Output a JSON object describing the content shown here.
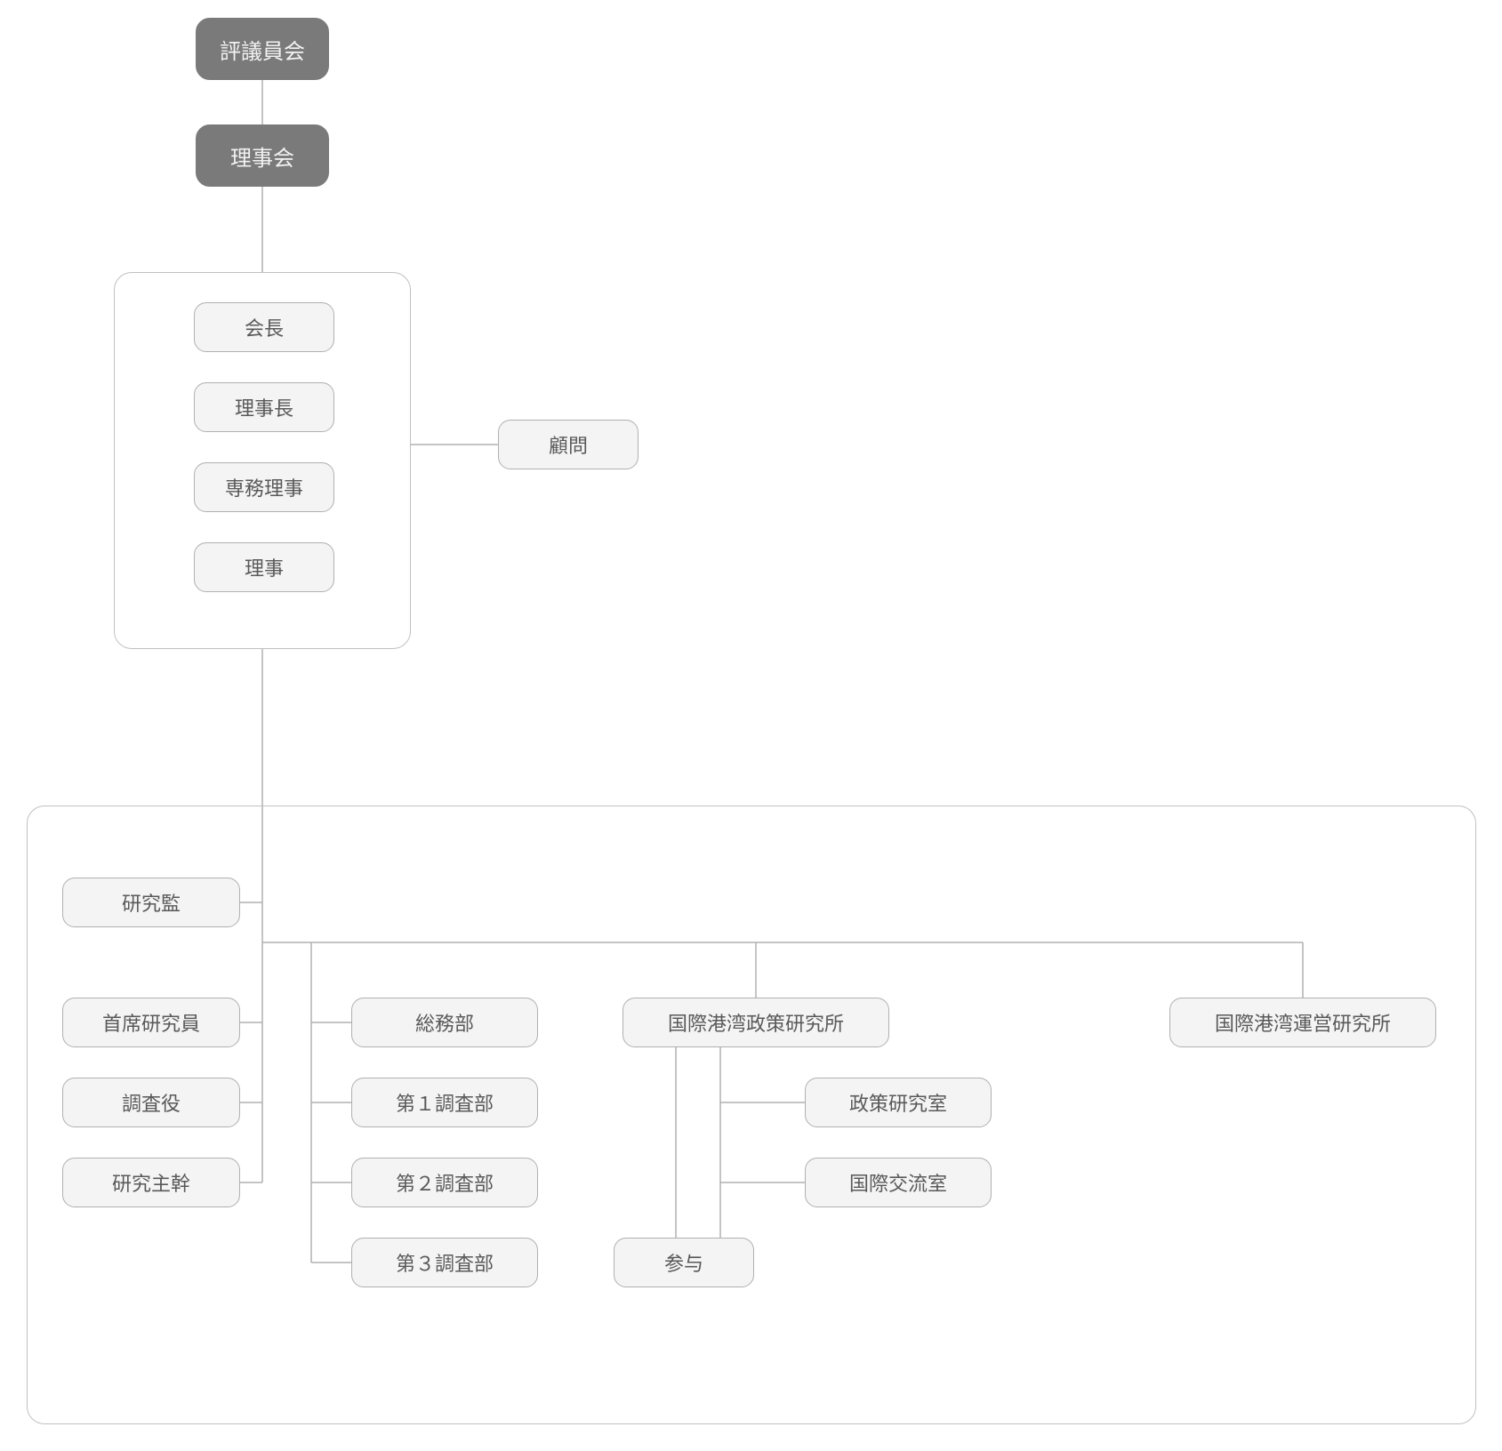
{
  "chart_data": {
    "type": "org-chart",
    "nodes": {
      "hyogiin": "評議員会",
      "rijikai": "理事会",
      "kaicho": "会長",
      "rijicho": "理事長",
      "senmu": "専務理事",
      "riji": "理事",
      "komon": "顧問",
      "kenkyukan": "研究監",
      "shuseki": "首席研究員",
      "chosayaku": "調査役",
      "kenkyushukan": "研究主幹",
      "somu": "総務部",
      "chosa1": "第１調査部",
      "chosa2": "第２調査部",
      "chosa3": "第３調査部",
      "seisaku_inst": "国際港湾政策研究所",
      "seisaku_room": "政策研究室",
      "koryu_room": "国際交流室",
      "sanyo": "参与",
      "unei_inst": "国際港湾運営研究所"
    },
    "edges": [
      [
        "hyogiin",
        "rijikai"
      ],
      [
        "rijikai",
        "exec_group"
      ],
      [
        "exec_group",
        "komon"
      ],
      [
        "exec_group",
        "lower_group"
      ],
      [
        "spine",
        "kenkyukan"
      ],
      [
        "spine",
        "shuseki"
      ],
      [
        "spine",
        "chosayaku"
      ],
      [
        "spine",
        "kenkyushukan"
      ],
      [
        "spine",
        "somu"
      ],
      [
        "spine",
        "chosa1"
      ],
      [
        "spine",
        "chosa2"
      ],
      [
        "spine",
        "chosa3"
      ],
      [
        "spine",
        "seisaku_inst"
      ],
      [
        "spine",
        "unei_inst"
      ],
      [
        "seisaku_inst",
        "seisaku_room"
      ],
      [
        "seisaku_inst",
        "koryu_room"
      ],
      [
        "seisaku_inst",
        "sanyo"
      ]
    ]
  },
  "colors": {
    "line": "#b0b0b0",
    "node_bg": "#f4f4f4",
    "node_border": "#b0b0b0",
    "dark_bg": "#7a7a7a",
    "dark_fg": "#f2f2f2",
    "text": "#595959"
  }
}
